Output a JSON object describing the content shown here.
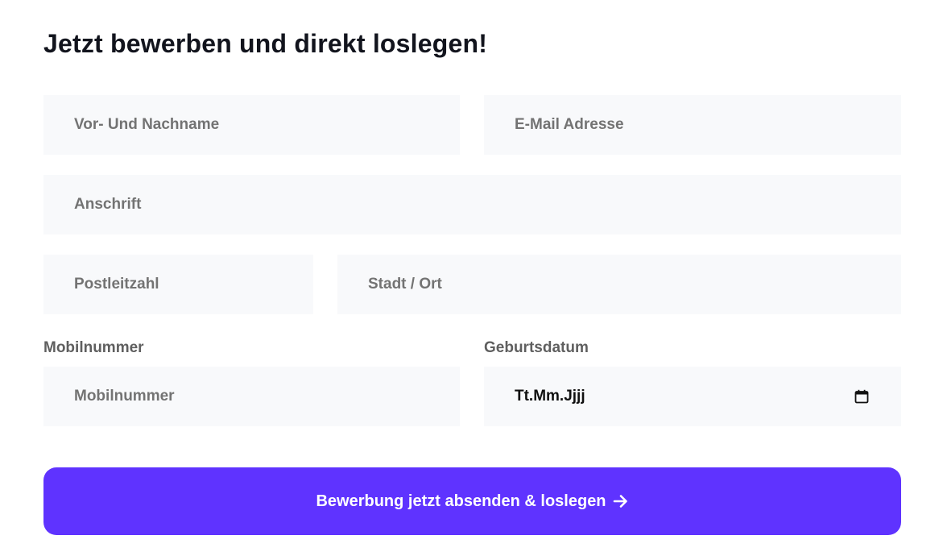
{
  "form": {
    "title": "Jetzt bewerben und direkt loslegen!",
    "name_placeholder": "Vor- Und Nachname",
    "email_placeholder": "E-Mail Adresse",
    "address_placeholder": "Anschrift",
    "zip_placeholder": "Postleitzahl",
    "city_placeholder": "Stadt / Ort",
    "mobile_label": "Mobilnummer",
    "mobile_placeholder": "Mobilnummer",
    "birthdate_label": "Geburtsdatum",
    "birthdate_value": "Tt.Mm.Jjjj",
    "submit_label": "Bewerbung jetzt absenden & loslegen"
  },
  "icons": {
    "calendar": "calendar-icon",
    "arrow": "arrow-right-icon"
  },
  "colors": {
    "accent": "#5f33ff",
    "field_background": "#f8f9fb",
    "title_text": "#12141d",
    "placeholder_text": "#737373"
  }
}
